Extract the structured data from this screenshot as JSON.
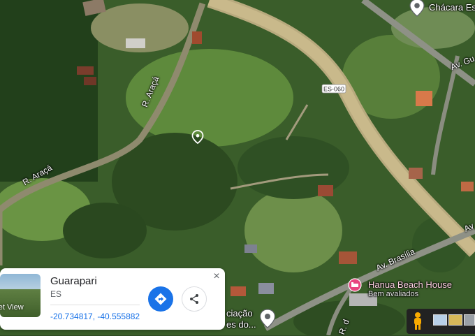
{
  "map": {
    "labels": {
      "street_araca_1": "R. Araçá",
      "street_araca_2": "R. Araçá",
      "av_brasilia": "Av. Brasília",
      "av_top_right": "Av. Gu",
      "av_right_edge": "Av",
      "road_bottom": "R. d",
      "highway_shield": "ES-060"
    },
    "places": {
      "chacara": "Chácara Es",
      "hanua_name": "Hanua Beach House",
      "hanua_sub": "Bem avaliados",
      "associacao_1": "ciação",
      "associacao_2": "es do..."
    },
    "colors": {
      "road": "#c9b98b",
      "hotel_pin": "#e8457f",
      "brand_blue": "#1a73e8"
    }
  },
  "card": {
    "thumb_label": "reet View",
    "title": "Guarapari",
    "subtitle": "ES",
    "coordinates": "-20.734817, -40.555882",
    "close_symbol": "×"
  },
  "icons": {
    "directions": "directions-icon",
    "share": "share-icon",
    "pegman": "pegman-icon"
  }
}
